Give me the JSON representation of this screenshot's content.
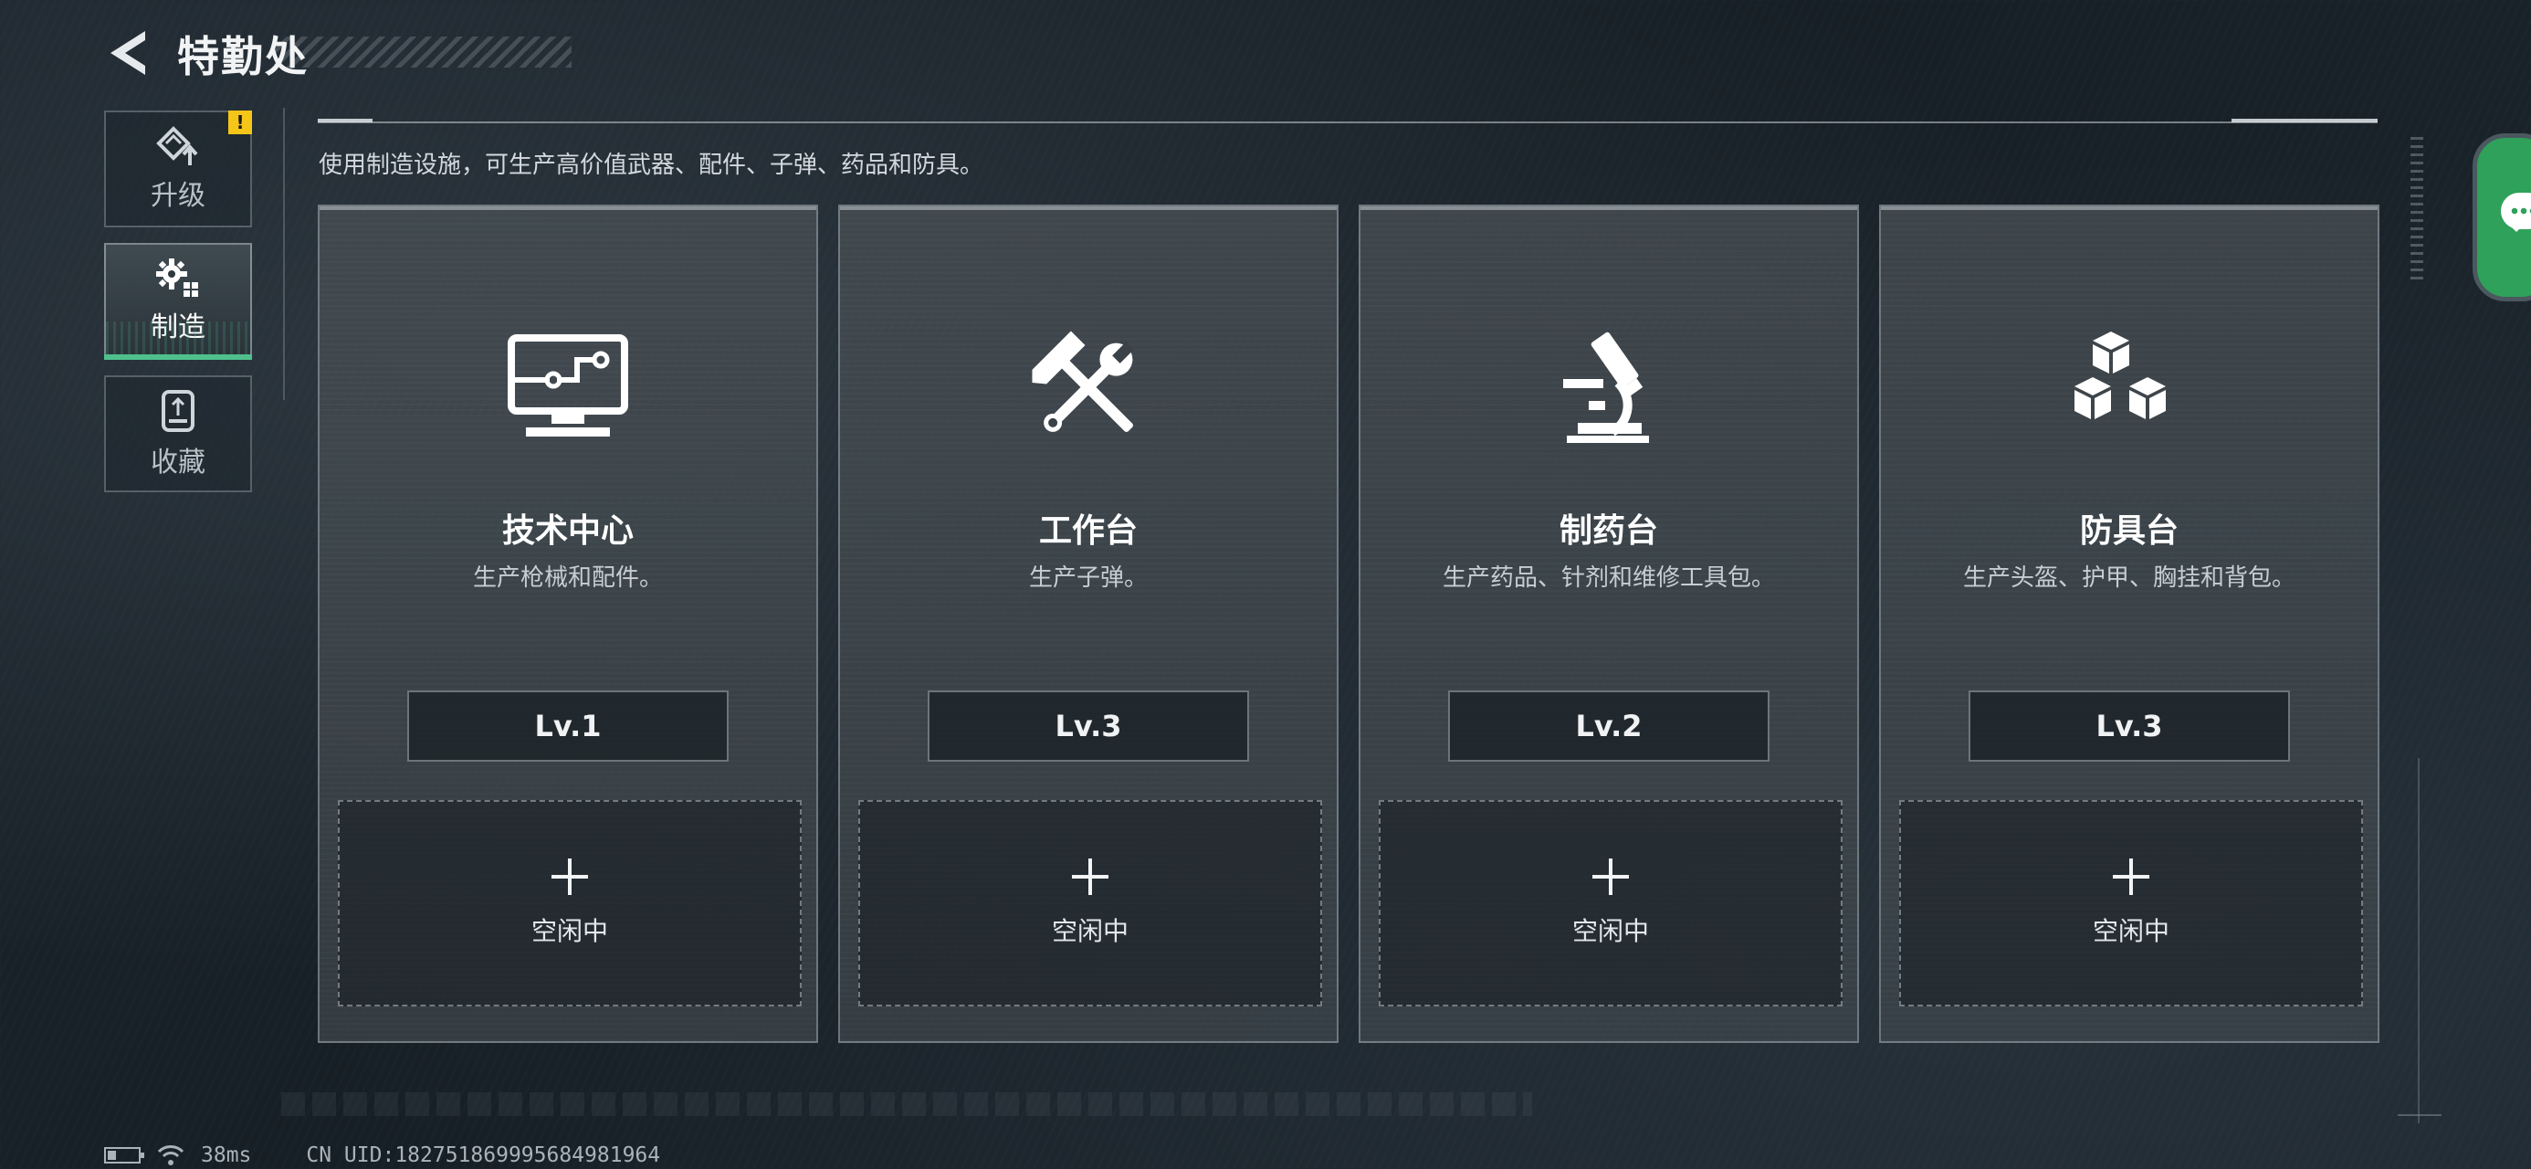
{
  "header": {
    "title": "特勤处",
    "description": "使用制造设施，可生产高价值武器、配件、子弹、药品和防具。"
  },
  "sidebar": {
    "items": [
      {
        "label": "升级",
        "icon": "upgrade-icon",
        "badge": "!",
        "active": false
      },
      {
        "label": "制造",
        "icon": "gears-icon",
        "active": true
      },
      {
        "label": "收藏",
        "icon": "collection-icon",
        "active": false
      }
    ]
  },
  "facilities": [
    {
      "name": "技术中心",
      "desc": "生产枪械和配件。",
      "level": "Lv.1",
      "icon": "computer-monitor-icon",
      "slot_label": "空闲中"
    },
    {
      "name": "工作台",
      "desc": "生产子弹。",
      "level": "Lv.3",
      "icon": "hammer-wrench-icon",
      "slot_label": "空闲中"
    },
    {
      "name": "制药台",
      "desc": "生产药品、针剂和维修工具包。",
      "level": "Lv.2",
      "icon": "microscope-icon",
      "slot_label": "空闲中"
    },
    {
      "name": "防具台",
      "desc": "生产头盔、护甲、胸挂和背包。",
      "level": "Lv.3",
      "icon": "stacked-cubes-icon",
      "slot_label": "空闲中"
    }
  ],
  "status": {
    "ping": "38ms",
    "uid": "CN UID:182751869995684981964"
  },
  "colors": {
    "accent_green": "#4fc08d",
    "warning": "#f5c518",
    "chat_green": "#2fa15a"
  }
}
